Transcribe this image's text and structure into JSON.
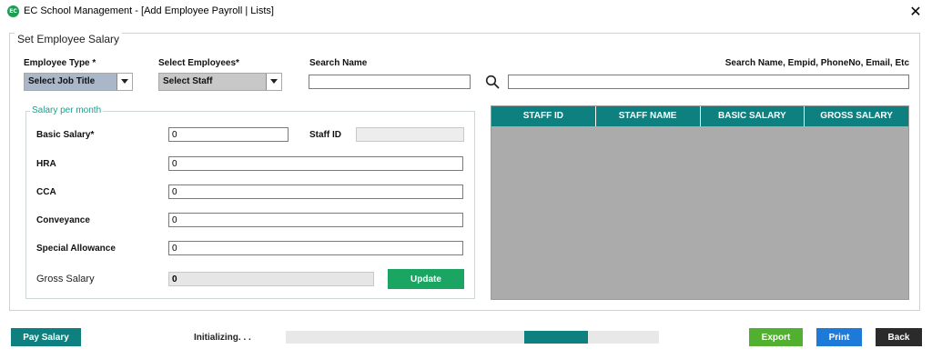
{
  "window": {
    "logo_text": "EC",
    "title": "EC School Management - [Add Employee Payroll | Lists]",
    "close_glyph": "✕"
  },
  "form": {
    "legend": "Set Employee Salary",
    "employee_type": {
      "label": "Employee Type *",
      "value": "Select Job Title"
    },
    "select_employees": {
      "label": "Select Employees*",
      "value": "Select Staff"
    },
    "search_name": {
      "label": "Search Name",
      "value": ""
    },
    "search_hint": "Search Name, Empid, PhoneNo, Email, Etc",
    "search_query": ""
  },
  "salary": {
    "legend": "Salary per month",
    "basic": {
      "label": "Basic Salary*",
      "value": "0"
    },
    "staff_id": {
      "label": "Staff ID",
      "value": ""
    },
    "hra": {
      "label": "HRA",
      "value": "0"
    },
    "cca": {
      "label": "CCA",
      "value": "0"
    },
    "conveyance": {
      "label": "Conveyance",
      "value": "0"
    },
    "special": {
      "label": "Special Allowance",
      "value": "0"
    },
    "gross": {
      "label": "Gross Salary",
      "value": "0"
    },
    "update_label": "Update"
  },
  "grid": {
    "columns": [
      "STAFF ID",
      "STAFF NAME",
      "BASIC SALARY",
      "GROSS SALARY"
    ],
    "rows": []
  },
  "footer": {
    "pay_label": "Pay Salary",
    "status": "Initializing. . .",
    "progress": {
      "segment_start": 0.64,
      "segment_end": 0.81
    },
    "export_label": "Export",
    "print_label": "Print",
    "back_label": "Back"
  },
  "colors": {
    "teal": "#0e8080",
    "green": "#1aa563",
    "export_green": "#52b030",
    "print_blue": "#1e7ad8",
    "back_dark": "#2b2b2b"
  },
  "icons": {
    "search": "search-icon",
    "dropdown": "chevron-down-icon",
    "close": "close-icon"
  }
}
